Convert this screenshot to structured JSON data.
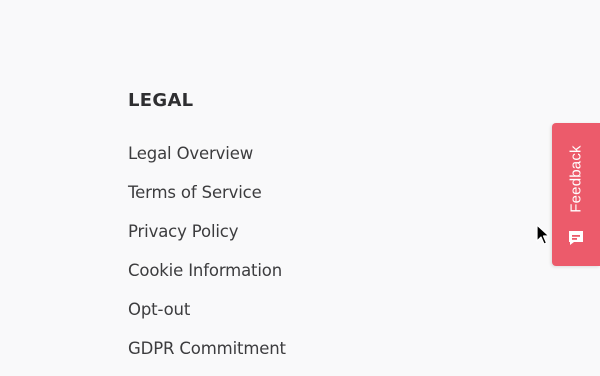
{
  "legal": {
    "title": "LEGAL",
    "links": [
      "Legal Overview",
      "Terms of Service",
      "Privacy Policy",
      "Cookie Information",
      "Opt-out",
      "GDPR Commitment"
    ]
  },
  "feedback": {
    "label": "Feedback",
    "icon": "chat-bubble-icon",
    "color": "#ec5b6b"
  },
  "colors": {
    "background": "#f9f9fa",
    "text": "#3c3c3e"
  }
}
